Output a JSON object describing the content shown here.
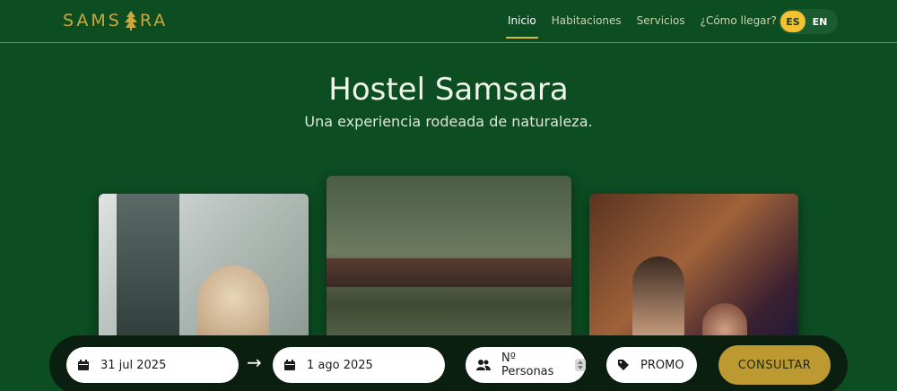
{
  "header": {
    "logo": {
      "before": "SAMS",
      "after": "RA"
    },
    "nav": [
      {
        "label": "Inicio",
        "active": true
      },
      {
        "label": "Habitaciones",
        "active": false
      },
      {
        "label": "Servicios",
        "active": false
      },
      {
        "label": "¿Cómo llegar?",
        "active": false
      }
    ],
    "languages": {
      "es": "ES",
      "en": "EN",
      "selected": "ES"
    }
  },
  "hero": {
    "title": "Hostel Samsara",
    "subtitle": "Una experiencia rodeada de naturaleza."
  },
  "booking": {
    "checkin": "31 jul 2025",
    "arrow": "→",
    "checkout": "1 ago 2025",
    "guests_placeholder": "Nº Personas",
    "promo_placeholder": "PROMO",
    "submit_label": "CONSULTAR"
  },
  "colors": {
    "background": "#0c4d22",
    "accent_gold": "#bd9a31",
    "lang_active": "#f2c230",
    "booking_bar": "#0b1f10"
  },
  "icons": {
    "logo": "pine-tree-icon",
    "date": "calendar-icon",
    "guests": "users-icon",
    "promo": "tag-icon"
  }
}
